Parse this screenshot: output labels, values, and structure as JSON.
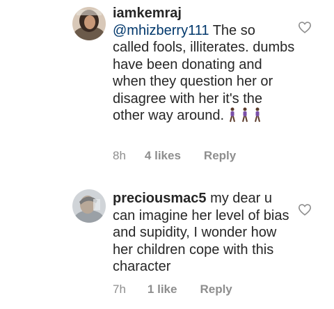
{
  "comments": [
    {
      "username": "iamkemraj",
      "mention": "@mhizberry111",
      "text": " The so called fools, illiterates. dumbs have been donating and when they question her or disagree with her it's the other way around.",
      "emoji": [
        "person-walking-icon",
        "person-walking-icon",
        "person-walking-icon"
      ],
      "time": "8h",
      "likes": "4 likes",
      "reply_label": "Reply"
    },
    {
      "username": "preciousmac5",
      "text": " my dear u can imagine her level of bias and supidity, I wonder how her children cope with this character",
      "time": "7h",
      "likes": "1 like",
      "reply_label": "Reply"
    }
  ],
  "colors": {
    "text": "#262626",
    "mention": "#00376b",
    "meta": "#8e8e8e",
    "heart_outline": "#8e8e8e"
  }
}
